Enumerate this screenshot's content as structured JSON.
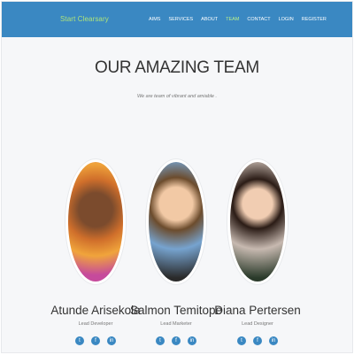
{
  "brand": "Start Clearsary",
  "nav": {
    "items": [
      {
        "label": "AIMS",
        "active": false
      },
      {
        "label": "SERVICES",
        "active": false
      },
      {
        "label": "ABOUT",
        "active": false
      },
      {
        "label": "TEAM",
        "active": true
      },
      {
        "label": "CONTACT",
        "active": false
      },
      {
        "label": "LOGIN",
        "active": false
      },
      {
        "label": "REGISTER",
        "active": false
      }
    ]
  },
  "heading": "OUR AMAZING TEAM",
  "subheading": "We are team of vibrant and amiable .",
  "team": [
    {
      "name": "Atunde Arisekola",
      "role": "Lead Developer"
    },
    {
      "name": "Salmon Temitope",
      "role": "Lead Marketer"
    },
    {
      "name": "Diana Pertersen",
      "role": "Lead Designer"
    }
  ],
  "social_icons": [
    "twitter-icon",
    "facebook-icon",
    "linkedin-icon"
  ]
}
